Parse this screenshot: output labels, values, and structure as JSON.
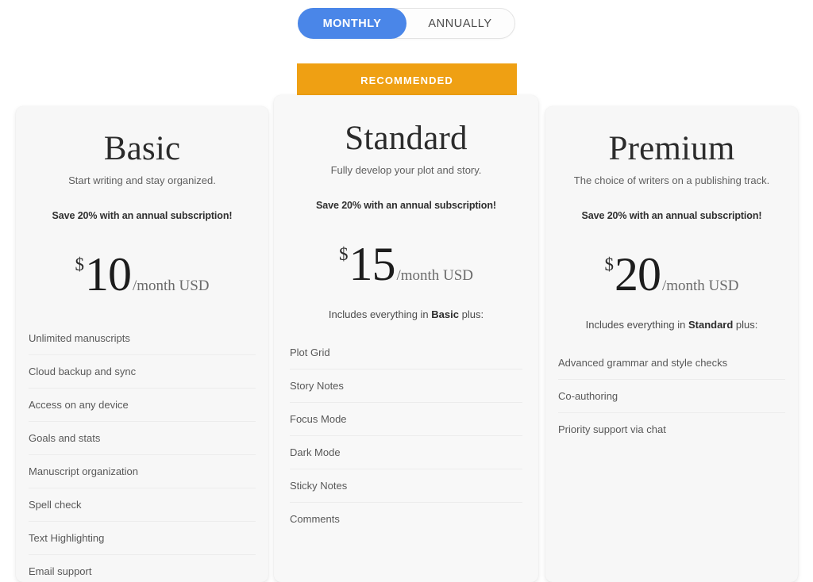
{
  "billing_toggle": {
    "monthly_label": "MONTHLY",
    "annually_label": "ANNUALLY",
    "selected": "MONTHLY",
    "active_color": "#4a86e8"
  },
  "recommended_badge": {
    "label": "RECOMMENDED",
    "color": "#efa013",
    "applies_to": "Standard"
  },
  "plans": [
    {
      "name": "Basic",
      "tagline": "Start writing and stay organized.",
      "save_note": "Save 20% with an annual subscription!",
      "currency": "$",
      "amount": "10",
      "period": "/month USD",
      "includes_prefix": "",
      "includes_bold": "",
      "includes_suffix": "",
      "features": [
        "Unlimited manuscripts",
        "Cloud backup and sync",
        "Access on any device",
        "Goals and stats",
        "Manuscript organization",
        "Spell check",
        "Text Highlighting",
        "Email support"
      ]
    },
    {
      "name": "Standard",
      "tagline": "Fully develop your plot and story.",
      "save_note": "Save 20% with an annual subscription!",
      "currency": "$",
      "amount": "15",
      "period": "/month USD",
      "includes_prefix": "Includes everything in ",
      "includes_bold": "Basic",
      "includes_suffix": " plus:",
      "features": [
        "Plot Grid",
        "Story Notes",
        "Focus Mode",
        "Dark Mode",
        "Sticky Notes",
        "Comments"
      ]
    },
    {
      "name": "Premium",
      "tagline": "The choice of writers on a publishing track.",
      "save_note": "Save 20% with an annual subscription!",
      "currency": "$",
      "amount": "20",
      "period": "/month USD",
      "includes_prefix": "Includes everything in ",
      "includes_bold": "Standard",
      "includes_suffix": " plus:",
      "features": [
        "Advanced grammar and style checks",
        "Co-authoring",
        "Priority support via chat"
      ]
    }
  ]
}
